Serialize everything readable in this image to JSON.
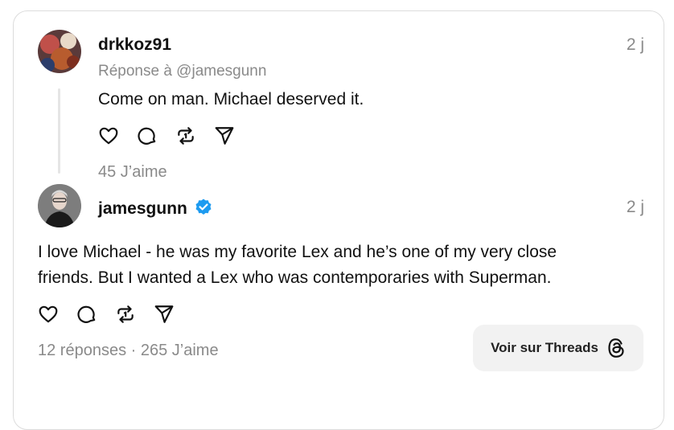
{
  "post1": {
    "username": "drkkoz91",
    "time": "2 j",
    "reply_to": "Réponse à @jamesgunn",
    "text": "Come on man.  Michael deserved it.",
    "likes": "45 J’aime"
  },
  "post2": {
    "username": "jamesgunn",
    "verified": true,
    "time": "2 j",
    "text_line1": "I love Michael - he was my favorite Lex and he’s one of my very close",
    "text_line2": "friends. But I wanted a Lex who was contemporaries with Superman.",
    "stats": "12 réponses · 265 J’aime"
  },
  "threads_button": {
    "label": "Voir sur Threads"
  },
  "icons": [
    "heart-icon",
    "comment-icon",
    "repost-icon",
    "share-icon",
    "threads-logo-icon",
    "verified-badge-icon"
  ],
  "colors": {
    "verified": "#1d9bf0",
    "muted_text": "#8a8a8a",
    "button_bg": "#f2f2f2"
  }
}
